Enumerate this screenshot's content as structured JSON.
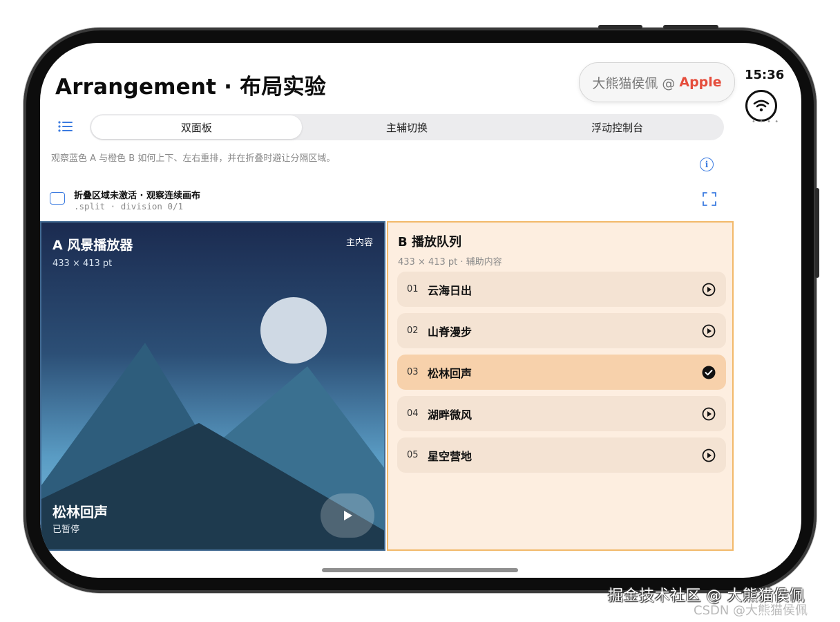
{
  "header": {
    "title": "Arrangement · 布局实验",
    "author_name": "大熊猫侯佩 @",
    "author_brand": "Apple",
    "status_time": "15:36",
    "wifi_icon": "wifi-icon"
  },
  "tabs": {
    "items": [
      "双面板",
      "主辅切换",
      "浮动控制台"
    ],
    "selected": 0
  },
  "description": "观察蓝色 A 与橙色 B 如何上下、左右重排，并在折叠时避让分隔区域。",
  "fold_status": {
    "title": "折叠区域未激活 · 观察连续画布",
    "subtitle": ".split · division 0/1"
  },
  "pane_a": {
    "title": "A 风景播放器",
    "dimensions": "433 × 413 pt",
    "tag": "主内容",
    "now_playing_title": "松林回声",
    "now_playing_status": "已暂停"
  },
  "pane_b": {
    "title": "B 播放队列",
    "dimensions": "433 × 413 pt · 辅助内容",
    "queue": [
      {
        "num": "01",
        "name": "云海日出",
        "state": "play"
      },
      {
        "num": "02",
        "name": "山脊漫步",
        "state": "play"
      },
      {
        "num": "03",
        "name": "松林回声",
        "state": "current"
      },
      {
        "num": "04",
        "name": "湖畔微风",
        "state": "play"
      },
      {
        "num": "05",
        "name": "星空营地",
        "state": "play"
      }
    ]
  },
  "watermarks": {
    "juejin": "掘金技术社区 @ 大熊猫侯佩",
    "csdn": "CSDN @大熊猫侯佩"
  },
  "colors": {
    "accent": "#3b7be0",
    "brand": "#e54d3c",
    "pane_a_border": "#426a92",
    "pane_b_border": "#f2b96a",
    "pane_b_bg": "#fdeee0",
    "queue_item_bg": "#f4e3d3",
    "queue_item_active_bg": "#f7d1ab"
  }
}
